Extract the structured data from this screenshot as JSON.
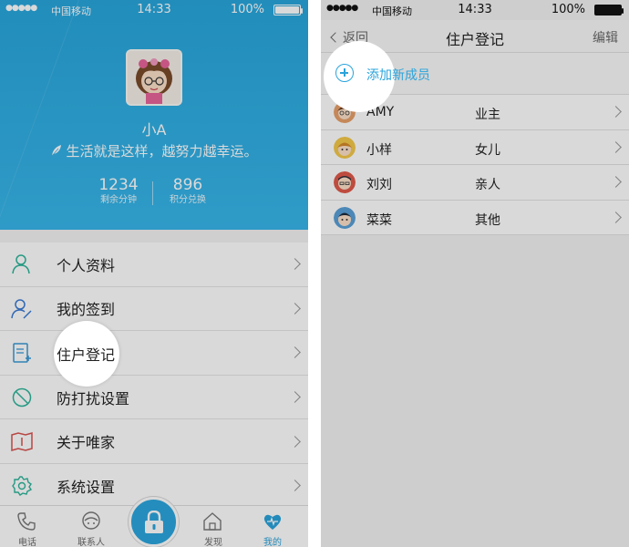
{
  "left": {
    "status": {
      "carrier": "中国移动",
      "time": "14:33",
      "battery": "100%"
    },
    "profile": {
      "name": "小A",
      "motto": "生活就是这样，越努力越幸运。",
      "stats": [
        {
          "value": "1234",
          "label": "剩余分钟"
        },
        {
          "value": "896",
          "label": "积分兑换"
        }
      ]
    },
    "menu": [
      {
        "label": "个人资料",
        "icon": "person-icon"
      },
      {
        "label": "我的签到",
        "icon": "checkin-icon"
      },
      {
        "label": "住户登记",
        "icon": "register-icon"
      },
      {
        "label": "防打扰设置",
        "icon": "no-disturb-icon"
      },
      {
        "label": "关于唯家",
        "icon": "about-icon"
      },
      {
        "label": "系统设置",
        "icon": "gear-icon"
      }
    ],
    "tabs": [
      {
        "label": "电话",
        "icon": "phone-icon"
      },
      {
        "label": "联系人",
        "icon": "contacts-icon"
      },
      {
        "label": "发现",
        "icon": "house-icon"
      },
      {
        "label": "我的",
        "icon": "heart-icon"
      }
    ],
    "center_icon": "lock-icon",
    "accent": "#2aa4dc"
  },
  "right": {
    "status": {
      "carrier": "中国移动",
      "time": "14:33",
      "battery": "100%"
    },
    "nav": {
      "back": "返回",
      "title": "住户登记",
      "edit": "编辑"
    },
    "add_label": "添加新成员",
    "members": [
      {
        "name": "AMY",
        "role": "业主"
      },
      {
        "name": "小样",
        "role": "女儿"
      },
      {
        "name": "刘刘",
        "role": "亲人"
      },
      {
        "name": "菜菜",
        "role": "其他"
      }
    ]
  }
}
